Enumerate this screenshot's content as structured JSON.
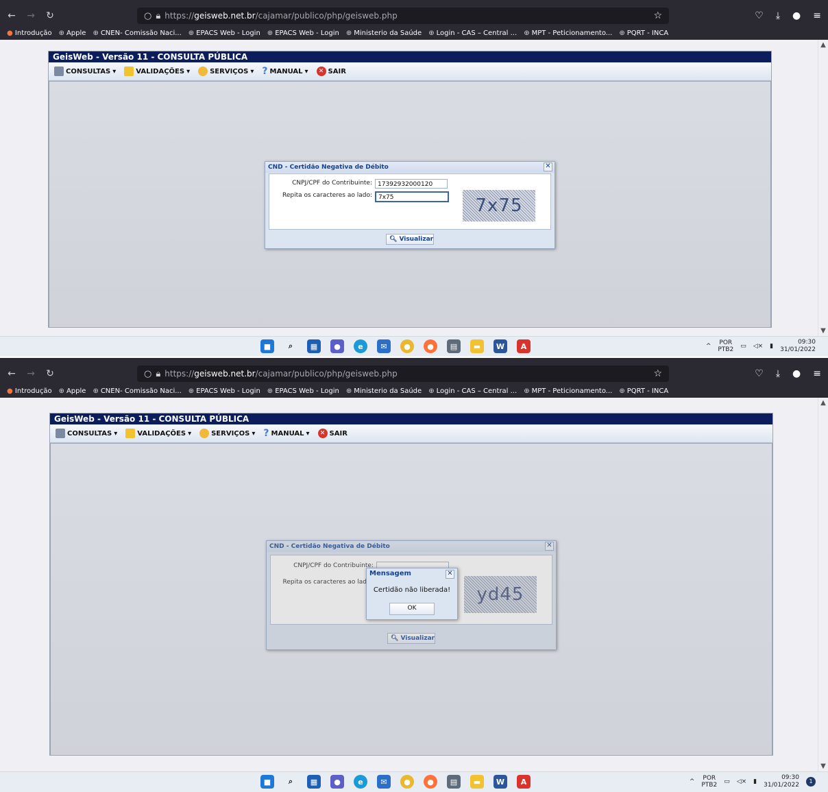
{
  "browser": {
    "url_host": "geisweb.net.br",
    "url_path": "/cajamar/publico/php/geisweb.php",
    "url_scheme": "https://",
    "bookmarks": [
      "Introdução",
      "Apple",
      "CNEN- Comissão Naci...",
      "EPACS Web - Login",
      "EPACS Web - Login",
      "Ministerio da Saúde",
      "Login - CAS – Central ...",
      "MPT - Peticionamento...",
      "PQRT - INCA"
    ]
  },
  "app": {
    "title": "GeisWeb - Versão 11 - CONSULTA PÚBLICA",
    "menu": {
      "consultas": "CONSULTAS",
      "validacoes": "VALIDAÇÕES",
      "servicos": "SERVIÇOS",
      "manual": "MANUAL",
      "sair": "SAIR"
    }
  },
  "dialog": {
    "title": "CND - Certidão Negativa de Débito",
    "cnpj_label": "CNPJ/CPF do Contribuinte:",
    "captcha_label": "Repita os caracteres ao lado:",
    "captcha_label_partial": "Repita os caracteres ao lad",
    "cnpj_label_partial": "CNPJ/CPF do Contribuinte:",
    "visualizar": "Visualizar"
  },
  "shot1": {
    "cnpj_value": "17392932000120",
    "captcha_value": "7x75",
    "captcha_image_text": "7x75"
  },
  "shot2": {
    "captcha_image_text": "yd45",
    "message": {
      "title": "Mensagem",
      "text": "Certidão não liberada!",
      "ok": "OK"
    }
  },
  "taskbar": {
    "lang_top": "POR",
    "lang_bottom": "PTB2",
    "time": "09:30",
    "date": "31/01/2022",
    "notif_count": "1"
  },
  "colors": {
    "title_bar": "#0b1d5c",
    "browser_chrome": "#2b2a33",
    "dialog_title_text": "#15428b"
  }
}
